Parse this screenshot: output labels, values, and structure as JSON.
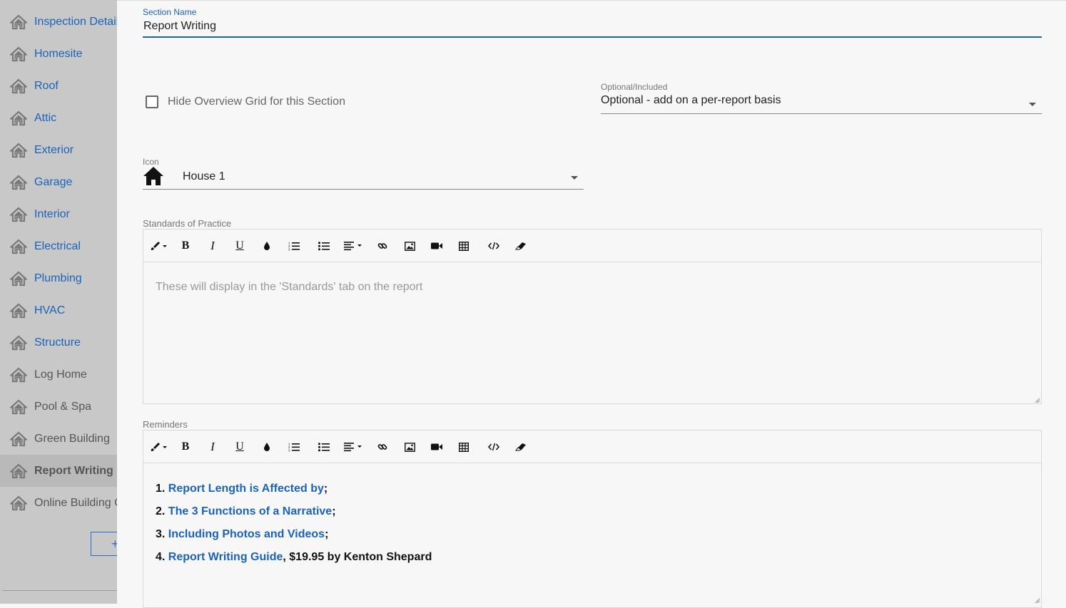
{
  "sidebar": {
    "items": [
      {
        "label": "Inspection Details",
        "style": "blue"
      },
      {
        "label": "Homesite",
        "style": "blue"
      },
      {
        "label": "Roof",
        "style": "blue"
      },
      {
        "label": "Attic",
        "style": "blue"
      },
      {
        "label": "Exterior",
        "style": "blue"
      },
      {
        "label": "Garage",
        "style": "blue"
      },
      {
        "label": "Interior",
        "style": "blue"
      },
      {
        "label": "Electrical",
        "style": "blue"
      },
      {
        "label": "Plumbing",
        "style": "blue"
      },
      {
        "label": "HVAC",
        "style": "blue"
      },
      {
        "label": "Structure",
        "style": "blue"
      },
      {
        "label": "Log Home",
        "style": "gray"
      },
      {
        "label": "Pool & Spa",
        "style": "gray"
      },
      {
        "label": "Green Building",
        "style": "gray"
      },
      {
        "label": "Report Writing",
        "style": "active"
      },
      {
        "label": "Online Building Codes",
        "style": "gray"
      }
    ],
    "add_button_label": "+"
  },
  "form": {
    "section_name": {
      "label": "Section Name",
      "value": "Report Writing"
    },
    "hide_overview": {
      "label": "Hide Overview Grid for this Section",
      "checked": false
    },
    "optional_included": {
      "label": "Optional/Included",
      "value": "Optional - add on a per-report basis"
    },
    "icon": {
      "label": "Icon",
      "value": "House 1",
      "icon_name": "house-icon"
    },
    "standards": {
      "label": "Standards of Practice",
      "placeholder": "These will display in the 'Standards' tab on the report"
    },
    "reminders": {
      "label": "Reminders",
      "items": [
        {
          "num": "1.",
          "link": "Report Length is Affected by",
          "suffix": ";"
        },
        {
          "num": "2.",
          "link": "The 3 Functions of a Narrative",
          "suffix": ";"
        },
        {
          "num": "3.",
          "link": "Including Photos and Videos",
          "suffix": ";"
        },
        {
          "num": "4.",
          "link": "Report Writing Guide",
          "suffix": ", $19.95 by Kenton Shepard"
        }
      ]
    }
  },
  "toolbar": [
    "style-brush-icon",
    "bold-icon",
    "italic-icon",
    "underline-icon",
    "color-drop-icon",
    "ordered-list-icon",
    "unordered-list-icon",
    "align-icon",
    "link-icon",
    "image-icon",
    "video-icon",
    "table-icon",
    "code-view-icon",
    "eraser-icon"
  ],
  "colors": {
    "accent": "#1a63b8",
    "sidebar_bg": "#c8c8c8",
    "active_bg": "#b9b9b9",
    "page_bg": "#f7f7f7"
  }
}
